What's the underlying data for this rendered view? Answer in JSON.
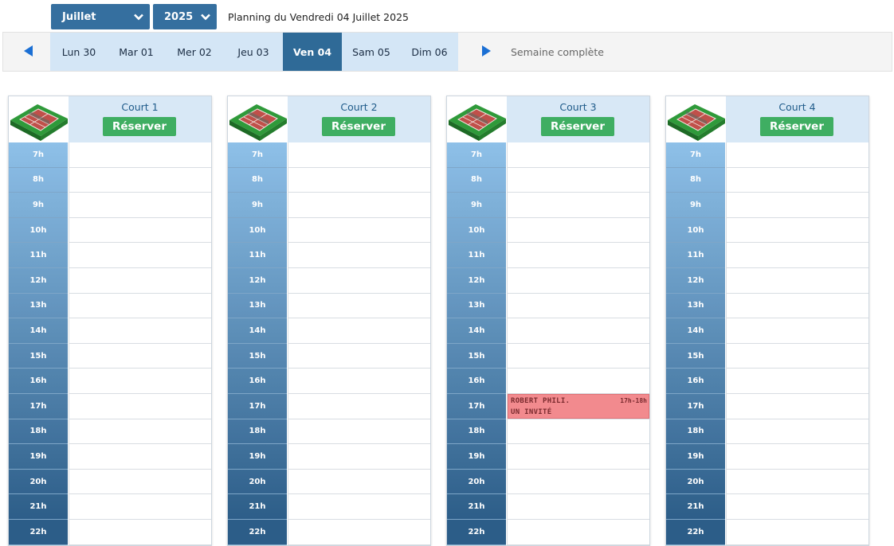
{
  "header": {
    "month": "Juillet",
    "year": "2025",
    "planning_title": "Planning du Vendredi 04 Juillet 2025"
  },
  "week": {
    "days": [
      "Lun 30",
      "Mar 01",
      "Mer 02",
      "Jeu 03",
      "Ven 04",
      "Sam 05",
      "Dim 06"
    ],
    "active_index": 4,
    "full_week_label": "Semaine complète"
  },
  "hours": [
    "7h",
    "8h",
    "9h",
    "10h",
    "11h",
    "12h",
    "13h",
    "14h",
    "15h",
    "16h",
    "17h",
    "18h",
    "19h",
    "20h",
    "21h",
    "22h"
  ],
  "courts": [
    {
      "name": "Court 1",
      "book_label": "Réserver"
    },
    {
      "name": "Court 2",
      "book_label": "Réserver"
    },
    {
      "name": "Court 3",
      "book_label": "Réserver"
    },
    {
      "name": "Court 4",
      "book_label": "Réserver"
    }
  ],
  "booking": {
    "court_index": 2,
    "hour": "17h",
    "player": "ROBERT PHILI.",
    "guest": "UN INVITÉ",
    "time": "17h-18h"
  },
  "colors": {
    "header_blue": "#356f9f",
    "active_day": "#2f6a97",
    "day_strip": "#d4e6f6",
    "book_green": "#3fae62",
    "booking_red": "#f28a8e",
    "hour_top": "#8ec0e8",
    "hour_bottom": "#2c5d88"
  },
  "icons": {
    "month_chevron": "chevron-down-icon",
    "prev": "triangle-left-icon",
    "next": "triangle-right-icon",
    "court": "tennis-court-icon"
  }
}
